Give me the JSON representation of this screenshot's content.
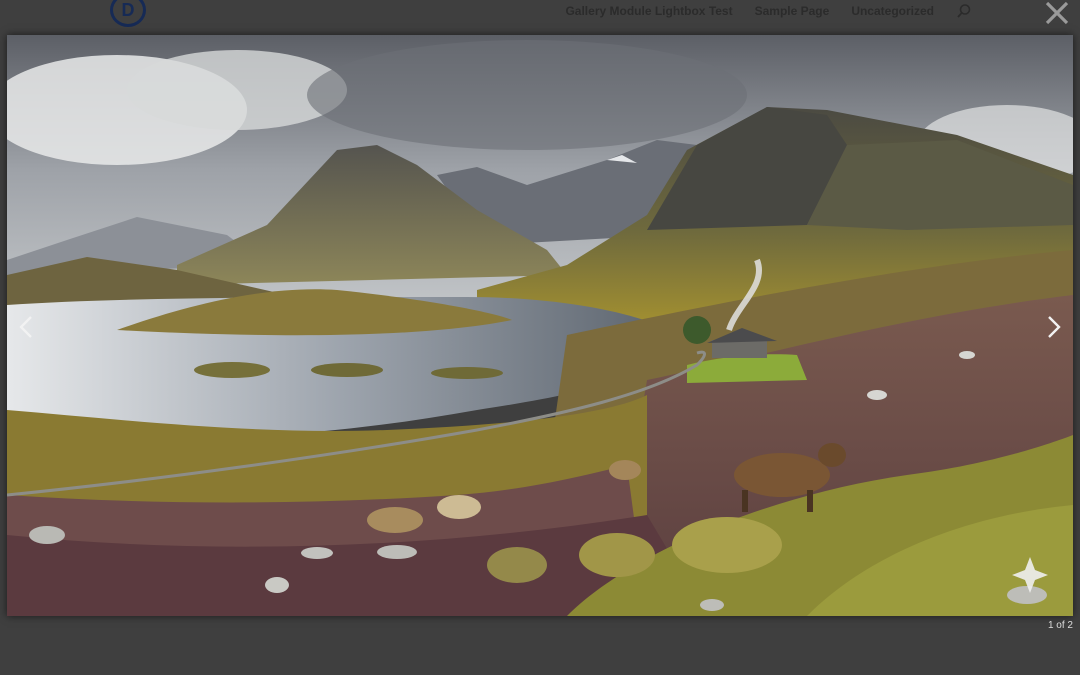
{
  "header": {
    "logo_letter": "D",
    "nav": [
      "Gallery Module Lightbox Test",
      "Sample Page",
      "Uncategorized"
    ],
    "search_icon": "search-icon"
  },
  "lightbox": {
    "close_icon": "close-icon",
    "prev_icon": "chevron-left-icon",
    "next_icon": "chevron-right-icon",
    "counter": "1 of 2",
    "image_subject": "highland-landscape-photo"
  },
  "colors": {
    "overlay": "#3f3f3f",
    "logo": "#162a55",
    "nav_text": "#2b2b2b",
    "counter_text": "#dcdcdc"
  }
}
